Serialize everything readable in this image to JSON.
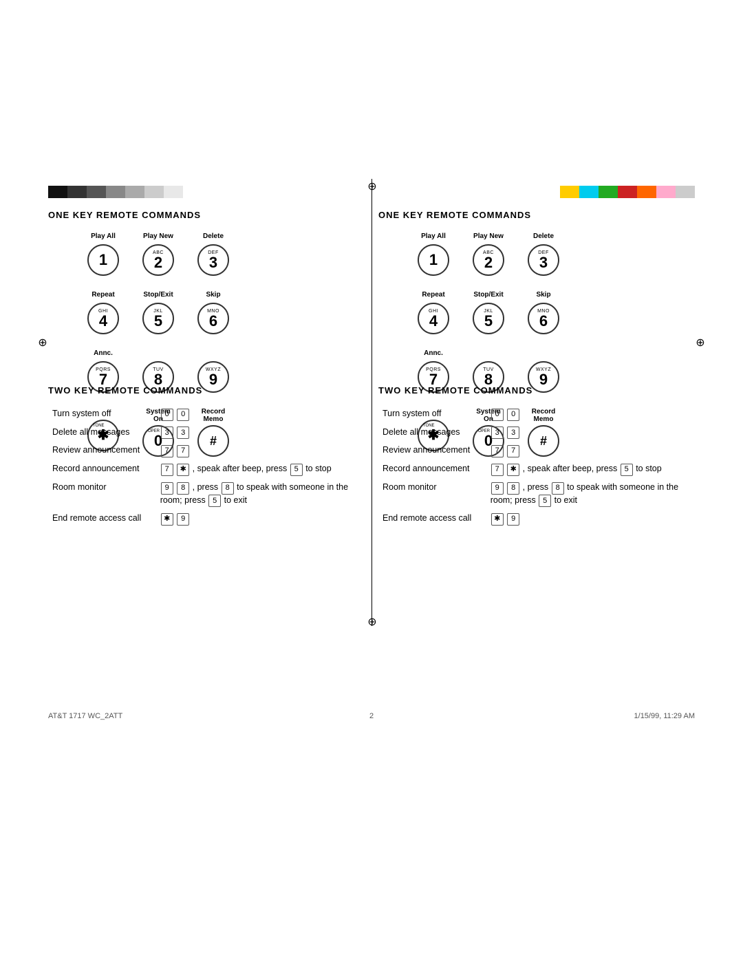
{
  "colors_left": [
    "#1a1a1a",
    "#3a3a3a",
    "#666",
    "#999",
    "#bbb",
    "#ddd",
    "#eee"
  ],
  "colors_right": [
    "#ffcc00",
    "#00ccff",
    "#00cc00",
    "#cc0000",
    "#ff6600",
    "#ff99cc",
    "#cccccc"
  ],
  "left_panel": {
    "one_key_title": "ONE KEY REMOTE COMMANDS",
    "keys": [
      {
        "label_top": "Play All",
        "letters": "",
        "number": "1",
        "row": 1,
        "col": 1
      },
      {
        "label_top": "Play New",
        "letters": "ABC",
        "number": "2",
        "row": 1,
        "col": 2
      },
      {
        "label_top": "Delete",
        "letters": "DEF",
        "number": "3",
        "row": 1,
        "col": 3
      },
      {
        "label_top": "Repeat",
        "letters": "GHI",
        "number": "4",
        "row": 2,
        "col": 1
      },
      {
        "label_top": "Stop/Exit",
        "letters": "JKL",
        "number": "5",
        "row": 2,
        "col": 2
      },
      {
        "label_top": "Skip",
        "letters": "MNO",
        "number": "6",
        "row": 2,
        "col": 3
      },
      {
        "label_top": "Annc.",
        "letters": "PQRS",
        "number": "7",
        "row": 3,
        "col": 1
      },
      {
        "label_top": "",
        "letters": "TUV",
        "number": "8",
        "row": 3,
        "col": 2
      },
      {
        "label_top": "",
        "letters": "WXYZ",
        "number": "9",
        "row": 3,
        "col": 3
      },
      {
        "label_top": "",
        "letters": "TONE",
        "number": "*",
        "type": "star",
        "row": 4,
        "col": 1
      },
      {
        "label_top": "System On",
        "letters": "OPER",
        "number": "0",
        "row": 4,
        "col": 2
      },
      {
        "label_top": "Record Memo",
        "letters": "",
        "number": "#",
        "type": "hash",
        "row": 4,
        "col": 3
      }
    ],
    "two_key_title": "TWO KEY REMOTE COMMANDS",
    "two_key_rows": [
      {
        "label": "Turn system off",
        "keys": "0 0",
        "desc": ""
      },
      {
        "label": "Delete all messages",
        "keys": "3 3",
        "desc": ""
      },
      {
        "label": "Review announcement",
        "keys": "7 7",
        "desc": ""
      },
      {
        "label": "Record announcement",
        "keys": "7 *",
        "desc": "speak after beep, press 5 to stop"
      },
      {
        "label": "Room monitor",
        "keys": "9 8",
        "desc": "press 8 to speak with someone in the room; press 5 to exit"
      },
      {
        "label": "End remote access call",
        "keys": "* 9",
        "desc": ""
      }
    ]
  },
  "right_panel": {
    "one_key_title": "ONE KEY REMOTE COMMANDS",
    "two_key_title": "TWO KEY REMOTE COMMANDS",
    "two_key_rows": [
      {
        "label": "Turn system off",
        "keys": "0 0",
        "desc": ""
      },
      {
        "label": "Delete all messages",
        "keys": "3 3",
        "desc": ""
      },
      {
        "label": "Review announcement",
        "keys": "7 7",
        "desc": ""
      },
      {
        "label": "Record announcement",
        "keys": "7 *",
        "desc": "speak after beep, press 5 to stop"
      },
      {
        "label": "Room monitor",
        "keys": "9 8",
        "desc": "press 8 to speak with someone in the room; press 5 to exit"
      },
      {
        "label": "End remote access call",
        "keys": "* 9",
        "desc": ""
      }
    ]
  },
  "footer": {
    "left": "AT&T 1717 WC_2ATT",
    "center": "2",
    "right": "1/15/99, 11:29 AM"
  }
}
